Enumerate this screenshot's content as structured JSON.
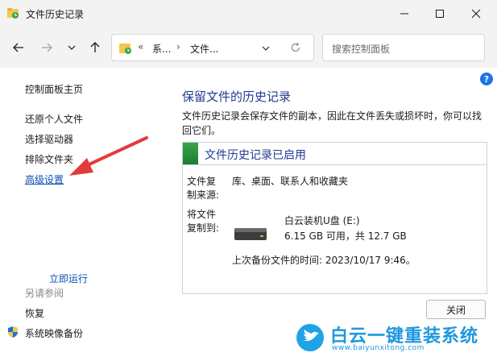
{
  "window": {
    "title": "文件历史记录"
  },
  "address": {
    "back_prefix": "«",
    "crumbs": [
      "系...",
      "文件..."
    ]
  },
  "search": {
    "placeholder": "搜索控制面板"
  },
  "sidebar": {
    "items": [
      {
        "label": "控制面板主页"
      },
      {
        "label": "还原个人文件"
      },
      {
        "label": "选择驱动器"
      },
      {
        "label": "排除文件夹"
      },
      {
        "label": "高级设置"
      }
    ],
    "see_also": {
      "heading": "另请参阅",
      "items": [
        {
          "label": "恢复"
        },
        {
          "label": "系统映像备份"
        }
      ]
    }
  },
  "help": {
    "label": "?"
  },
  "main": {
    "title": "保留文件的历史记录",
    "description": "文件历史记录会保存文件的副本，因此在文件丢失或损坏时，你可以找回它们。",
    "status": {
      "title": "文件历史记录已启用",
      "source_label_1": "文件复",
      "source_label_2": "制来源:",
      "source_value": "库、桌面、联系人和收藏夹",
      "dest_label_1": "将文件",
      "dest_label_2": "复制到:",
      "drive_name": "白云装机U盘 (E:)",
      "drive_space": "6.15 GB 可用，共 12.7 GB",
      "last_backup": "上次备份文件的时间: 2023/10/17 9:46。",
      "run_now": "立即运行"
    },
    "close_button": "关闭"
  },
  "watermark": {
    "brand": "白云一键重装系统",
    "url": "www.baiyunxitong.com"
  },
  "colors": {
    "link": "#0b4fb3",
    "title": "#1f3a93",
    "status_green": "#2e9a3f",
    "arrow_red": "#e23b3b",
    "watermark_blue": "#1f97de"
  }
}
